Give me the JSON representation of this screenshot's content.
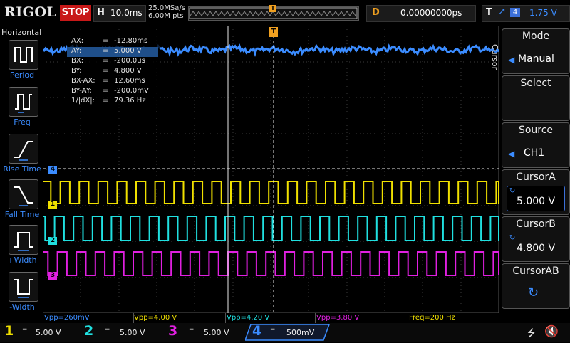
{
  "topbar": {
    "logo": "RIGOL",
    "run_state": "STOP",
    "timebase_letter": "H",
    "timebase": "10.0ms",
    "sample_rate": "25.0MSa/s",
    "memory_depth": "6.00M pts",
    "delay_letter": "D",
    "delay": "0.00000000ps",
    "trigger_letter": "T",
    "trigger_source": "4",
    "trigger_level": "1.75 V"
  },
  "left_panel": {
    "title": "Horizontal",
    "items": [
      {
        "label": "Period",
        "icon": "period-icon"
      },
      {
        "label": "Freq",
        "icon": "freq-icon"
      },
      {
        "label": "Rise Time",
        "icon": "rise-time-icon"
      },
      {
        "label": "Fall Time",
        "icon": "fall-time-icon"
      },
      {
        "label": "+Width",
        "icon": "pos-width-icon"
      },
      {
        "label": "-Width",
        "icon": "neg-width-icon"
      }
    ]
  },
  "cursor_readout": [
    {
      "key": "AX:",
      "eq": "=",
      "value": "-12.80ms"
    },
    {
      "key": "AY:",
      "eq": "=",
      "value": "5.000 V"
    },
    {
      "key": "BX:",
      "eq": "=",
      "value": "-200.0us"
    },
    {
      "key": "BY:",
      "eq": "=",
      "value": "4.800 V"
    },
    {
      "key": "BX-AX:",
      "eq": "=",
      "value": "12.60ms"
    },
    {
      "key": "BY-AY:",
      "eq": "=",
      "value": "-200.0mV"
    },
    {
      "key": "1/|dX|:",
      "eq": "=",
      "value": "79.36 Hz"
    }
  ],
  "channel_markers": {
    "ch1": "1",
    "ch2": "2",
    "ch3": "3",
    "ch4": "4"
  },
  "measurements": [
    {
      "text": "Vpp=260mV",
      "color": "#3b8cff"
    },
    {
      "text": "Vpp=4.00 V",
      "color": "#f0e000"
    },
    {
      "text": "Vpp=4.20 V",
      "color": "#20e0e0"
    },
    {
      "text": "Vpp=3.80 V",
      "color": "#e020e0"
    },
    {
      "text": "Freq=200 Hz",
      "color": "#f0e000"
    }
  ],
  "right_panel": {
    "menu_title": "Cursor",
    "mode_title": "Mode",
    "mode_value": "Manual",
    "select_title": "Select",
    "source_title": "Source",
    "source_value": "CH1",
    "cursor_a_title": "CursorA",
    "cursor_a_value": "5.000 V",
    "cursor_b_title": "CursorB",
    "cursor_b_value": "4.800 V",
    "cursor_ab_title": "CursorAB"
  },
  "channels": [
    {
      "num": "1",
      "scale": "5.00 V",
      "color": "#f0e000"
    },
    {
      "num": "2",
      "scale": "5.00 V",
      "color": "#20e0e0"
    },
    {
      "num": "3",
      "scale": "5.00 V",
      "color": "#e020e0"
    },
    {
      "num": "4",
      "scale": "500mV",
      "color": "#3b8cff"
    }
  ],
  "colors": {
    "ch1": "#f0e000",
    "ch2": "#20e0e0",
    "ch3": "#e020e0",
    "ch4": "#3b8cff",
    "stop": "#c81818",
    "delay": "#f0a020"
  },
  "icons": {
    "usb": "usb-icon",
    "speaker": "speaker-mute-icon"
  }
}
